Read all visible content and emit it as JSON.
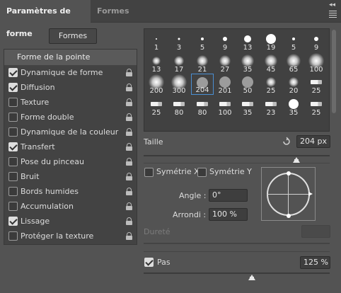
{
  "tabs": {
    "active": "Paramètres de forme",
    "inactive": "Formes"
  },
  "panel_icons": {
    "collapse": "double-chevron-icon",
    "menu": "hamburger-menu-icon"
  },
  "formes_button": "Formes",
  "options": {
    "header": "Forme de la pointe",
    "items": [
      {
        "label": "Dynamique de forme",
        "checked": true
      },
      {
        "label": "Diffusion",
        "checked": true
      },
      {
        "label": "Texture",
        "checked": false
      },
      {
        "label": "Forme double",
        "checked": false
      },
      {
        "label": "Dynamique de la couleur",
        "checked": false
      },
      {
        "label": "Transfert",
        "checked": true
      },
      {
        "label": "Pose du pinceau",
        "checked": false
      },
      {
        "label": "Bruit",
        "checked": false
      },
      {
        "label": "Bords humides",
        "checked": false
      },
      {
        "label": "Accumulation",
        "checked": false
      },
      {
        "label": "Lissage",
        "checked": true
      },
      {
        "label": "Protéger la texture",
        "checked": false
      }
    ]
  },
  "brushes": [
    {
      "size": "1",
      "style": "hard",
      "d": 2
    },
    {
      "size": "3",
      "style": "hard",
      "d": 3
    },
    {
      "size": "5",
      "style": "hard",
      "d": 4
    },
    {
      "size": "9",
      "style": "hard",
      "d": 6
    },
    {
      "size": "13",
      "style": "hard",
      "d": 10
    },
    {
      "size": "19",
      "style": "hard",
      "d": 14
    },
    {
      "size": "5",
      "style": "hard",
      "d": 4
    },
    {
      "size": "9",
      "style": "hard",
      "d": 6
    },
    {
      "size": "13",
      "style": "soft",
      "d": 12
    },
    {
      "size": "17",
      "style": "soft",
      "d": 14
    },
    {
      "size": "21",
      "style": "soft",
      "d": 16
    },
    {
      "size": "27",
      "style": "soft",
      "d": 16
    },
    {
      "size": "35",
      "style": "soft",
      "d": 18
    },
    {
      "size": "45",
      "style": "soft",
      "d": 18
    },
    {
      "size": "65",
      "style": "soft",
      "d": 20
    },
    {
      "size": "100",
      "style": "soft",
      "d": 22
    },
    {
      "size": "200",
      "style": "soft",
      "d": 22
    },
    {
      "size": "300",
      "style": "soft",
      "d": 22
    },
    {
      "size": "204",
      "style": "grey",
      "d": 16,
      "selected": true
    },
    {
      "size": "201",
      "style": "grey",
      "d": 16
    },
    {
      "size": "50",
      "style": "grey",
      "d": 16
    },
    {
      "size": "25",
      "style": "soft",
      "d": 14
    },
    {
      "size": "20",
      "style": "soft",
      "d": 14
    },
    {
      "size": "25",
      "style": "tool",
      "d": 0
    },
    {
      "size": "25",
      "style": "tool",
      "d": 0
    },
    {
      "size": "80",
      "style": "tool",
      "d": 0
    },
    {
      "size": "80",
      "style": "tool",
      "d": 0
    },
    {
      "size": "100",
      "style": "tool",
      "d": 0
    },
    {
      "size": "35",
      "style": "tool",
      "d": 0
    },
    {
      "size": "23",
      "style": "tool",
      "d": 0
    },
    {
      "size": "35",
      "style": "hard",
      "d": 14
    },
    {
      "size": "25",
      "style": "tool",
      "d": 0
    }
  ],
  "size": {
    "label": "Taille",
    "value": "204 px",
    "reset_icon": "reset-icon",
    "level": 0.82
  },
  "symmetry": {
    "x_label": "Symétrie X",
    "y_label": "Symétrie Y",
    "x_checked": false,
    "y_checked": false
  },
  "angle": {
    "label": "Angle :",
    "value": "0°"
  },
  "roundness": {
    "label": "Arrondi :",
    "value": "100 %"
  },
  "hardness": {
    "label": "Dureté",
    "value": ""
  },
  "spacing": {
    "label": "Pas",
    "value": "125 %",
    "checked": true,
    "level": 0.58
  },
  "colors": {
    "panel": "#535353",
    "tabbar": "#424242",
    "selection": "#4a8fd3"
  }
}
